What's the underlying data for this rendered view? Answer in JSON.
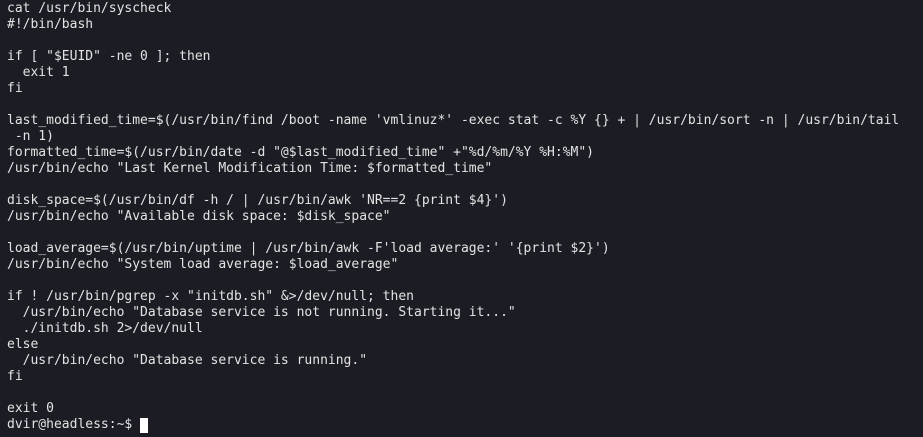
{
  "terminal": {
    "lines": [
      "cat /usr/bin/syscheck",
      "#!/bin/bash",
      "",
      "if [ \"$EUID\" -ne 0 ]; then",
      "  exit 1",
      "fi",
      "",
      "last_modified_time=$(/usr/bin/find /boot -name 'vmlinuz*' -exec stat -c %Y {} + | /usr/bin/sort -n | /usr/bin/tail",
      " -n 1)",
      "formatted_time=$(/usr/bin/date -d \"@$last_modified_time\" +\"%d/%m/%Y %H:%M\")",
      "/usr/bin/echo \"Last Kernel Modification Time: $formatted_time\"",
      "",
      "disk_space=$(/usr/bin/df -h / | /usr/bin/awk 'NR==2 {print $4}')",
      "/usr/bin/echo \"Available disk space: $disk_space\"",
      "",
      "load_average=$(/usr/bin/uptime | /usr/bin/awk -F'load average:' '{print $2}')",
      "/usr/bin/echo \"System load average: $load_average\"",
      "",
      "if ! /usr/bin/pgrep -x \"initdb.sh\" &>/dev/null; then",
      "  /usr/bin/echo \"Database service is not running. Starting it...\"",
      "  ./initdb.sh 2>/dev/null",
      "else",
      "  /usr/bin/echo \"Database service is running.\"",
      "fi",
      "",
      "exit 0"
    ],
    "prompt": "dvir@headless:~$"
  }
}
